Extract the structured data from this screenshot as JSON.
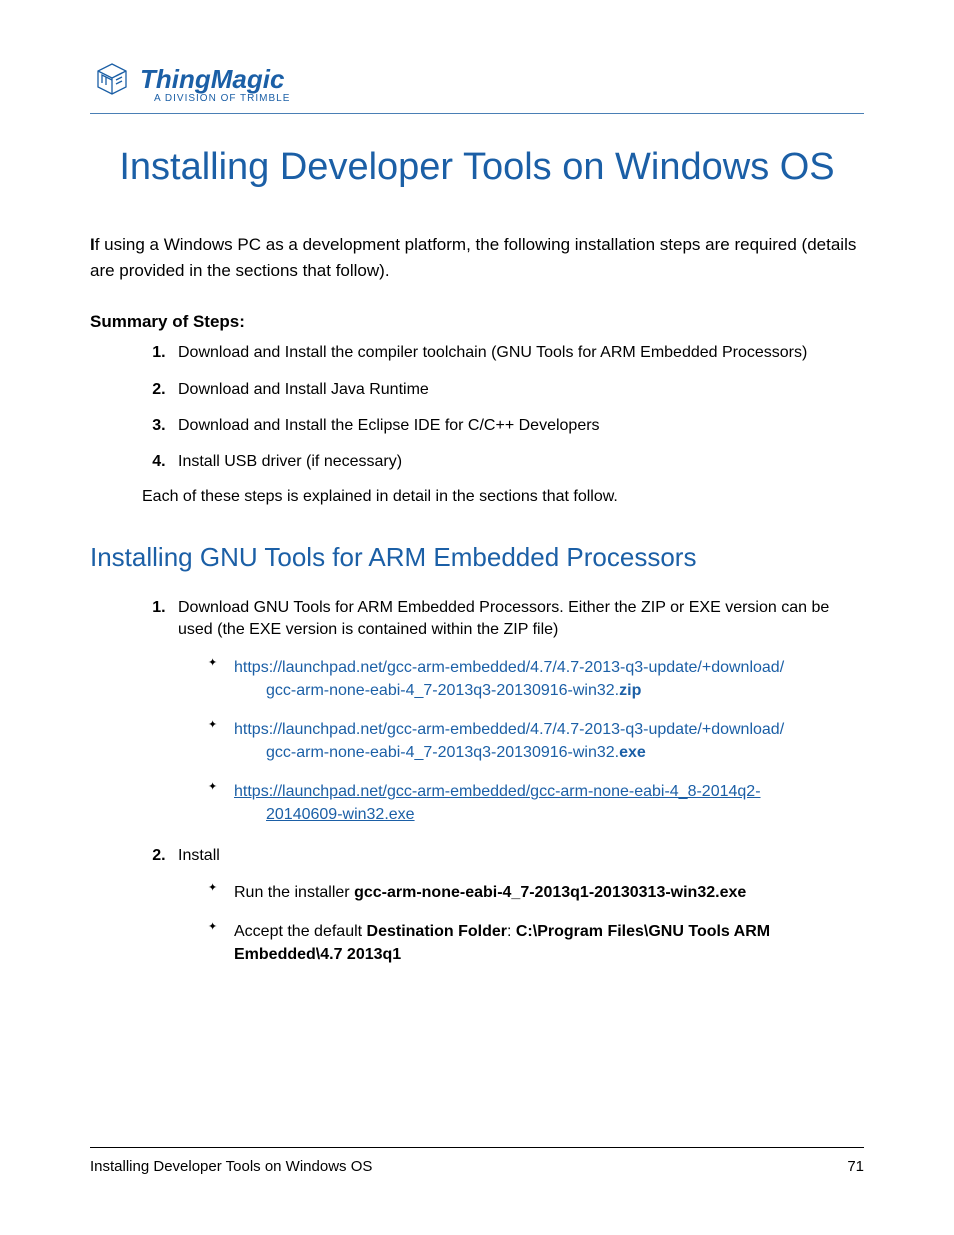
{
  "header": {
    "brand": "ThingMagic",
    "tagline": "A DIVISION OF TRIMBLE"
  },
  "title": "Installing Developer Tools on Windows OS",
  "intro": {
    "first_letter": "I",
    "rest": "f using a Windows PC as a development platform, the following installation steps are required (details are provided in the sections that follow)."
  },
  "summary": {
    "heading": "Summary of Steps:",
    "items": [
      "Download and Install the compiler toolchain (GNU Tools for ARM Embedded Processors)",
      "Download and Install Java Runtime",
      "Download and Install the Eclipse IDE for C/C++ Developers",
      "Install USB driver (if necessary)"
    ],
    "after": "Each of these steps is explained in detail in the sections that follow."
  },
  "section1": {
    "heading": "Installing GNU Tools for ARM Embedded Processors",
    "step1_text": "Download GNU Tools for ARM Embedded Processors. Either the ZIP or EXE version can be used (the EXE version is contained within the ZIP file)",
    "link1_a": "https://launchpad.net/gcc-arm-embedded/4.7/4.7-2013-q3-update/+download/",
    "link1_b": "gcc-arm-none-eabi-4_7-2013q3-20130916-win32.",
    "link1_ext": "zip",
    "link2_a": "https://launchpad.net/gcc-arm-embedded/4.7/4.7-2013-q3-update/+download/",
    "link2_b": "gcc-arm-none-eabi-4_7-2013q3-20130916-win32.",
    "link2_ext": "exe",
    "link3_a": "https://launchpad.net/gcc-arm-embedded/gcc-arm-none-eabi-4_8-2014q2-",
    "link3_b": "20140609-win32.exe",
    "step2_text": "Install",
    "run_pre": "Run the installer ",
    "run_bold": "gcc-arm-none-eabi-4_7-2013q1-20130313-win32.exe",
    "dest_pre": "Accept the default ",
    "dest_label": "Destination Folder",
    "dest_sep": ": ",
    "dest_path": "C:\\Program Files\\GNU Tools ARM Embedded\\4.7 2013q1"
  },
  "footer": {
    "left": "Installing Developer Tools on Windows OS",
    "right": "71"
  }
}
